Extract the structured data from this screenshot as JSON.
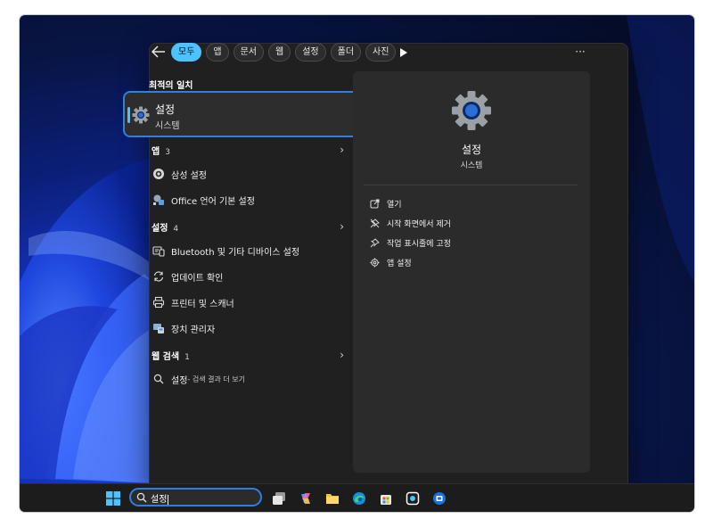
{
  "filters": {
    "back_icon": "arrow-left-icon",
    "tabs": [
      {
        "label": "모두",
        "active": true
      },
      {
        "label": "앱"
      },
      {
        "label": "문서"
      },
      {
        "label": "웹"
      },
      {
        "label": "설정"
      },
      {
        "label": "폴더"
      },
      {
        "label": "사진"
      }
    ],
    "more_label": "···"
  },
  "results": {
    "best_match_header": "최적의 일치",
    "best_match": {
      "title": "설정",
      "subtitle": "시스템",
      "icon": "gear-icon"
    },
    "groups": [
      {
        "name": "앱",
        "count": "3",
        "items": [
          {
            "label": "삼성 설정",
            "icon": "samsung-settings-icon"
          },
          {
            "label": "Office 언어 기본 설정",
            "icon": "office-language-icon"
          }
        ]
      },
      {
        "name": "설정",
        "count": "4",
        "items": [
          {
            "label": "Bluetooth 및 기타 디바이스 설정",
            "icon": "bluetooth-devices-icon"
          },
          {
            "label": "업데이트 확인",
            "icon": "sync-icon"
          },
          {
            "label": "프린터 및 스캐너",
            "icon": "printer-icon"
          },
          {
            "label": "장치 관리자",
            "icon": "device-manager-icon"
          }
        ]
      },
      {
        "name": "웹 검색",
        "count": "1",
        "items": [
          {
            "label": "설정",
            "suffix": " - 검색 결과 더 보기",
            "icon": "search-icon"
          }
        ]
      }
    ]
  },
  "detail": {
    "title": "설정",
    "subtitle": "시스템",
    "actions": [
      {
        "label": "열기",
        "icon": "open-icon"
      },
      {
        "label": "시작 화면에서 제거",
        "icon": "unpin-icon"
      },
      {
        "label": "작업 표시줄에 고정",
        "icon": "pin-icon"
      },
      {
        "label": "앱 설정",
        "icon": "gear-icon"
      }
    ]
  },
  "taskbar": {
    "search_value": "설정",
    "apps": [
      "start-icon",
      "task-view-icon",
      "copilot-icon",
      "file-explorer-icon",
      "edge-icon",
      "store-icon",
      "screen-capture-icon",
      "app-icon"
    ]
  },
  "colors": {
    "accent": "#4cc2ff",
    "focus_border": "#2f7fe0",
    "panel": "#202020",
    "detail_panel": "#2b2b2b"
  }
}
